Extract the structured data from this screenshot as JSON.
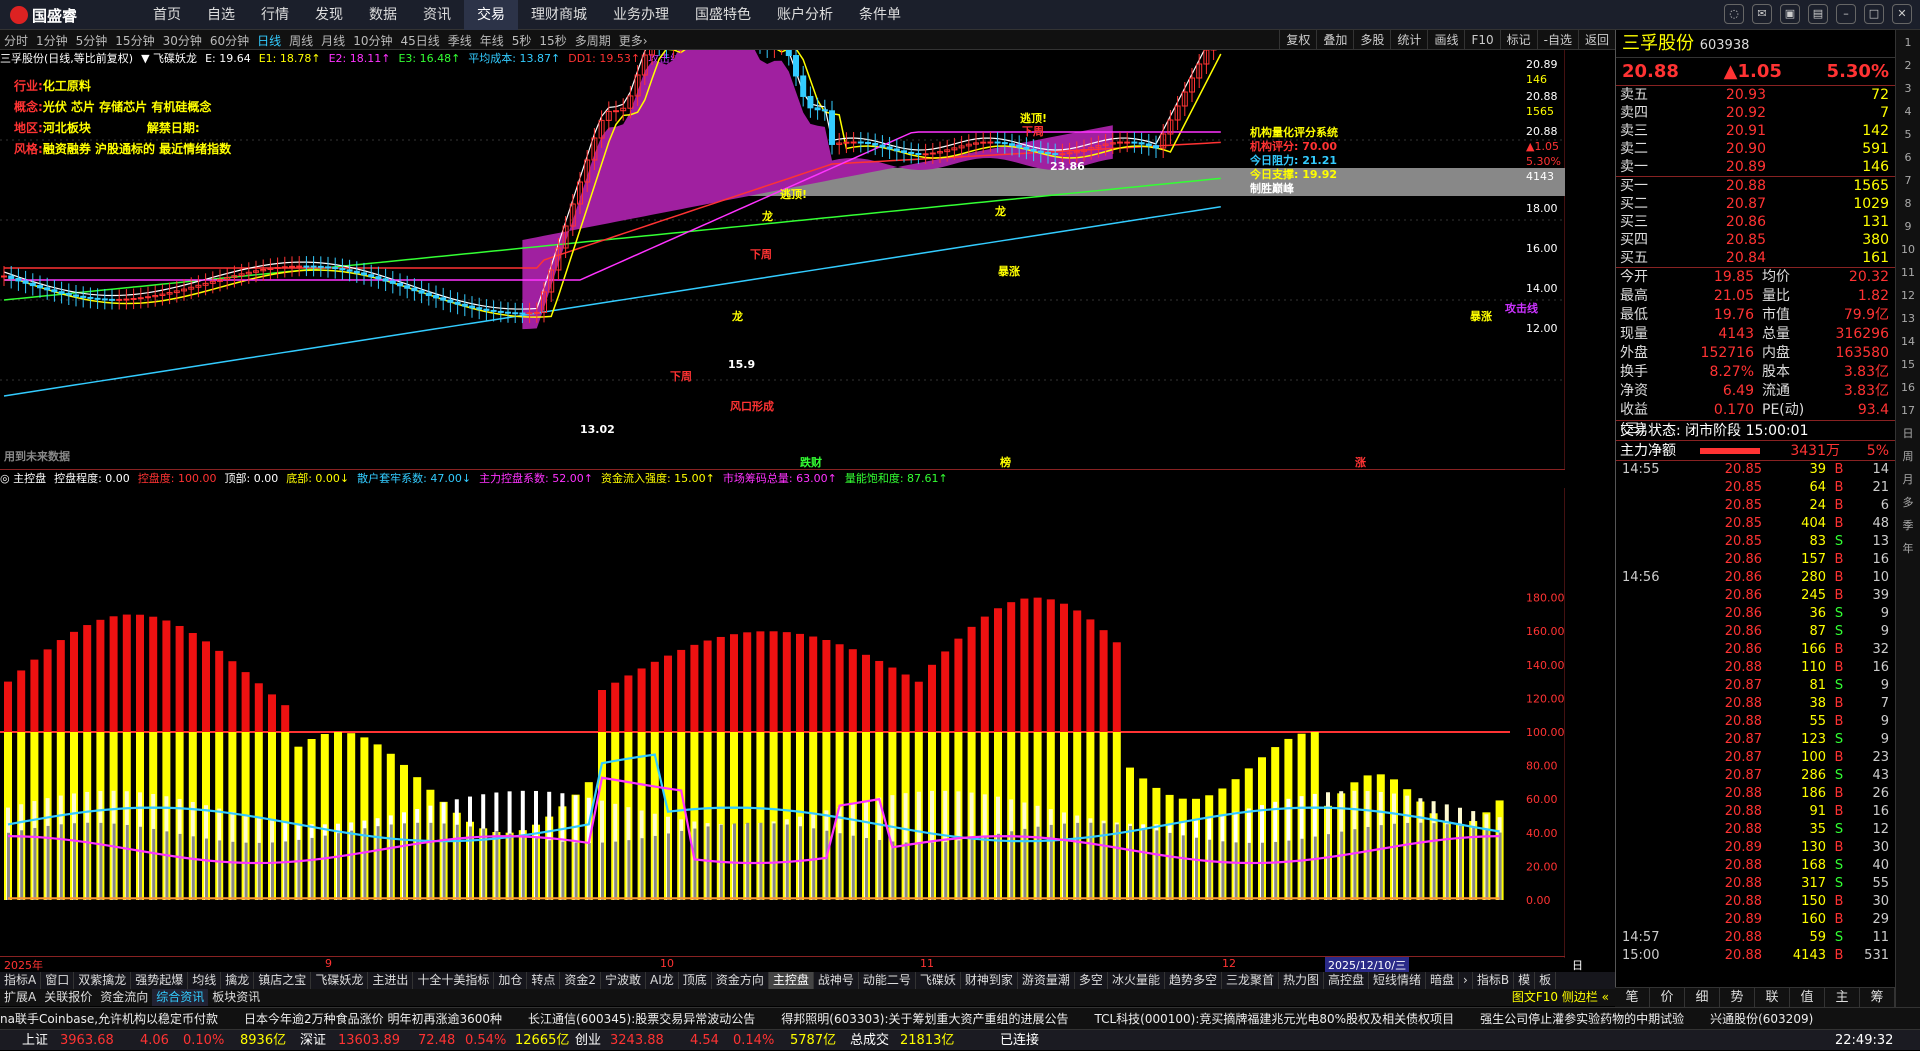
{
  "app": {
    "logo": "国盛睿"
  },
  "menu": [
    "首页",
    "自选",
    "行情",
    "发现",
    "数据",
    "资讯",
    "交易",
    "理财商城",
    "业务办理",
    "国盛特色",
    "账户分析",
    "条件单"
  ],
  "menu_active": 6,
  "periods": [
    "分时",
    "1分钟",
    "5分钟",
    "15分钟",
    "30分钟",
    "60分钟",
    "日线",
    "周线",
    "月线",
    "10分钟",
    "45日线",
    "季线",
    "年线",
    "5秒",
    "15秒",
    "多周期",
    "更多›"
  ],
  "period_active": 6,
  "tools": [
    "复权",
    "叠加",
    "多股",
    "统计",
    "画线",
    "F10",
    "标记",
    "-自选",
    "返回"
  ],
  "kline_info": [
    {
      "t": "三孚股份(日线,等比前复权)",
      "c": "#fff"
    },
    {
      "t": "▼ 飞碟妖龙",
      "c": "#fff"
    },
    {
      "t": "E: 19.64",
      "c": "#fff"
    },
    {
      "t": "E1: 18.78↑",
      "c": "#ff0"
    },
    {
      "t": "E2: 18.11↑",
      "c": "#f3f"
    },
    {
      "t": "E3: 16.48↑",
      "c": "#3f3"
    },
    {
      "t": "平均成本: 13.87↑",
      "c": "#3cf"
    },
    {
      "t": "DD1: 19.53↑",
      "c": "#f33"
    },
    {
      "t": "攻击线: 17.98",
      "c": "#c3f"
    }
  ],
  "annotations": [
    {
      "label": "行业:",
      "value": "化工原料"
    },
    {
      "label": "概念:",
      "value": "光伏 芯片 存储芯片 有机硅概念"
    },
    {
      "label": "地区:",
      "value": "河北板块",
      "label2": "解禁日期:",
      "value2": ""
    },
    {
      "label": "风格:",
      "value": "融资融券 沪股通标的 最近情绪指数"
    }
  ],
  "score": {
    "title": "机构量化评分系统",
    "l1": "机构评分:  70.00",
    "l2": "今日阻力:  21.21",
    "l3": "今日支撑:  19.92",
    "l4": "制胜巅峰"
  },
  "chart_marks": {
    "sell1": "逃顶!",
    "sell2": "逃顶!",
    "dragon": "龙",
    "dragon2": "龙",
    "dragon3": "龙",
    "xiazhou": "下周",
    "xiazhou2": "下周",
    "xiazhou3": "下周",
    "storm": "暴涨",
    "storm2": "暴涨",
    "wind": "风口形成",
    "attack": "攻击线",
    "p_hi": "23.86",
    "p_lo": "13.02",
    "p_mid": "15.9",
    "future": "用到未来数据",
    "lbl_a": "跌财",
    "lbl_b": "榜",
    "lbl_c": "涨"
  },
  "y_main": [
    {
      "v": "20.89"
    },
    {
      "v": "146"
    },
    {
      "v": "20.88"
    },
    {
      "v": "1565"
    },
    {
      "v": "20.88"
    },
    {
      "v": "▲1.05"
    },
    {
      "v": "5.30%"
    },
    {
      "v": "4143"
    },
    {
      "v": "18.00"
    },
    {
      "v": "16.00"
    },
    {
      "v": "14.00"
    },
    {
      "v": "12.00"
    }
  ],
  "indi_info": [
    {
      "t": "◎ 主控盘",
      "c": "#fff"
    },
    {
      "t": "控盘程度: 0.00",
      "c": "#fff"
    },
    {
      "t": "控盘度: 100.00",
      "c": "#f33"
    },
    {
      "t": "顶部: 0.00",
      "c": "#fff"
    },
    {
      "t": "底部: 0.00↓",
      "c": "#ff0"
    },
    {
      "t": "散户套牢系数: 47.00↓",
      "c": "#3cf"
    },
    {
      "t": "主力控盘系数: 52.00↑",
      "c": "#f3f"
    },
    {
      "t": "资金流入强度: 15.00↑",
      "c": "#ff0"
    },
    {
      "t": "市场筹码总量: 63.00↑",
      "c": "#f3f"
    },
    {
      "t": "量能饱和度: 87.61↑",
      "c": "#3f3"
    }
  ],
  "y_sub": [
    "180.00",
    "160.00",
    "140.00",
    "120.00",
    "100.00",
    "80.00",
    "60.00",
    "40.00",
    "20.00",
    "0.00"
  ],
  "dates": [
    "2025年",
    "9",
    "10",
    "11",
    "12",
    "2025/12/10/三",
    "日线"
  ],
  "tabs1": [
    "指标A",
    "窗口",
    "双紫擒龙",
    "强势起爆",
    "均线",
    "擒龙",
    "镇店之宝",
    "飞碟妖龙",
    "主进出",
    "十全十美指标",
    "加仓",
    "转点",
    "资金2",
    "宁波敢",
    "AI龙",
    "顶底",
    "资金方向",
    "主控盘",
    "战神号",
    "动能二号",
    "飞碟妖",
    "财神到家",
    "游资量潮",
    "多空",
    "冰火量能",
    "趋势多空",
    "三龙聚首",
    "热力图",
    "高控盘",
    "短线情绪",
    "暗盘",
    "›",
    "指标B",
    "模",
    "板"
  ],
  "tabs1_active": 17,
  "tabs2": [
    "扩展A",
    "关联报价",
    "资金流向",
    "综合资讯",
    "板块资讯"
  ],
  "tabs2_active": 3,
  "tabs2_right": "图文F10 侧边栏 «",
  "ticker": [
    "na联手Coinbase,允许机构以稳定币付款",
    "日本今年逾2万种食品涨价 明年初再涨逾3600种",
    "长江通信(600345):股票交易异常波动公告",
    "得邦照明(603303):关于筹划重大资产重组的进展公告",
    "TCL科技(000100):竞买摘牌福建兆元光电80%股权及相关债权项目",
    "强生公司停止灌参实验药物的中期试验",
    "兴通股份(603209)"
  ],
  "status": {
    "sh_label": "上证",
    "sh_val": "3963.68",
    "sh_chg": "4.06",
    "sh_pct": "0.10%",
    "sh_amt": "8936亿",
    "sz_label": "深证",
    "sz_val": "13603.89",
    "sz_chg": "72.48",
    "sz_pct": "0.54%",
    "sz_amt": "12665亿",
    "cy_label": "创业",
    "cy_val": "3243.88",
    "cy_chg": "4.54",
    "cy_pct": "0.14%",
    "cy_amt": "5787亿",
    "total_label": "总成交",
    "total_val": "21813亿",
    "conn": "已连接",
    "time": "22:49:32"
  },
  "panel": {
    "name": "三孚股份",
    "code": "603938",
    "price": "20.88",
    "chg": "▲1.05",
    "pct": "5.30%",
    "sells": [
      {
        "l": "卖五",
        "p": "20.93",
        "v": "72"
      },
      {
        "l": "卖四",
        "p": "20.92",
        "v": "7"
      },
      {
        "l": "卖三",
        "p": "20.91",
        "v": "142"
      },
      {
        "l": "卖二",
        "p": "20.90",
        "v": "591"
      },
      {
        "l": "卖一",
        "p": "20.89",
        "v": "146"
      }
    ],
    "buys": [
      {
        "l": "买一",
        "p": "20.88",
        "v": "1565"
      },
      {
        "l": "买二",
        "p": "20.87",
        "v": "1029"
      },
      {
        "l": "买三",
        "p": "20.86",
        "v": "131"
      },
      {
        "l": "买四",
        "p": "20.85",
        "v": "380"
      },
      {
        "l": "买五",
        "p": "20.84",
        "v": "161"
      }
    ],
    "stats": [
      {
        "a": "今开",
        "b": "19.85",
        "c": "均价",
        "d": "20.32"
      },
      {
        "a": "最高",
        "b": "21.05",
        "c": "量比",
        "d": "1.82"
      },
      {
        "a": "最低",
        "b": "19.76",
        "c": "市值",
        "d": "79.9亿"
      },
      {
        "a": "现量",
        "b": "4143",
        "c": "总量",
        "d": "316296"
      },
      {
        "a": "外盘",
        "b": "152716",
        "c": "内盘",
        "d": "163580"
      },
      {
        "a": "换手",
        "b": "8.27%",
        "c": "股本",
        "d": "3.83亿"
      },
      {
        "a": "净资",
        "b": "6.49",
        "c": "流通",
        "d": "3.83亿"
      },
      {
        "a": "收益(三)",
        "b": "0.170",
        "c": "PE(动)",
        "d": "93.4"
      }
    ],
    "trade_state": "交易状态: 闭市阶段 15:00:01",
    "flow_label": "主力净额",
    "flow_val": "3431万",
    "flow_pct": "5%",
    "ticks": [
      {
        "t": "14:55",
        "p": "20.85",
        "v": "39",
        "bs": "B",
        "n": "14"
      },
      {
        "t": "",
        "p": "20.85",
        "v": "64",
        "bs": "B",
        "n": "21"
      },
      {
        "t": "",
        "p": "20.85",
        "v": "24",
        "bs": "B",
        "n": "6"
      },
      {
        "t": "",
        "p": "20.85",
        "v": "404",
        "bs": "B",
        "n": "48"
      },
      {
        "t": "",
        "p": "20.85",
        "v": "83",
        "bs": "S",
        "n": "13"
      },
      {
        "t": "",
        "p": "20.86",
        "v": "157",
        "bs": "B",
        "n": "16"
      },
      {
        "t": "14:56",
        "p": "20.86",
        "v": "280",
        "bs": "B",
        "n": "10"
      },
      {
        "t": "",
        "p": "20.86",
        "v": "245",
        "bs": "B",
        "n": "39"
      },
      {
        "t": "",
        "p": "20.86",
        "v": "36",
        "bs": "S",
        "n": "9"
      },
      {
        "t": "",
        "p": "20.86",
        "v": "87",
        "bs": "S",
        "n": "9"
      },
      {
        "t": "",
        "p": "20.86",
        "v": "166",
        "bs": "B",
        "n": "32"
      },
      {
        "t": "",
        "p": "20.88",
        "v": "110",
        "bs": "B",
        "n": "16"
      },
      {
        "t": "",
        "p": "20.87",
        "v": "81",
        "bs": "S",
        "n": "9"
      },
      {
        "t": "",
        "p": "20.88",
        "v": "38",
        "bs": "B",
        "n": "7"
      },
      {
        "t": "",
        "p": "20.88",
        "v": "55",
        "bs": "B",
        "n": "9"
      },
      {
        "t": "",
        "p": "20.87",
        "v": "123",
        "bs": "S",
        "n": "9"
      },
      {
        "t": "",
        "p": "20.87",
        "v": "100",
        "bs": "B",
        "n": "23"
      },
      {
        "t": "",
        "p": "20.87",
        "v": "286",
        "bs": "S",
        "n": "43"
      },
      {
        "t": "",
        "p": "20.88",
        "v": "186",
        "bs": "B",
        "n": "26"
      },
      {
        "t": "",
        "p": "20.88",
        "v": "91",
        "bs": "B",
        "n": "16"
      },
      {
        "t": "",
        "p": "20.88",
        "v": "35",
        "bs": "S",
        "n": "12"
      },
      {
        "t": "",
        "p": "20.89",
        "v": "130",
        "bs": "B",
        "n": "30"
      },
      {
        "t": "",
        "p": "20.88",
        "v": "168",
        "bs": "S",
        "n": "40"
      },
      {
        "t": "",
        "p": "20.88",
        "v": "317",
        "bs": "S",
        "n": "55"
      },
      {
        "t": "",
        "p": "20.88",
        "v": "150",
        "bs": "B",
        "n": "30"
      },
      {
        "t": "",
        "p": "20.89",
        "v": "160",
        "bs": "B",
        "n": "29"
      },
      {
        "t": "14:57",
        "p": "20.88",
        "v": "59",
        "bs": "S",
        "n": "11"
      },
      {
        "t": "15:00",
        "p": "20.88",
        "v": "4143",
        "bs": "B",
        "n": "531"
      }
    ],
    "bottom_tabs": [
      "笔",
      "价",
      "细",
      "势",
      "联",
      "值",
      "主",
      "筹"
    ]
  },
  "sidebar": [
    "1",
    "2",
    "3",
    "4",
    "5",
    "6",
    "7",
    "8",
    "9",
    "10",
    "11",
    "12",
    "13",
    "14",
    "15",
    "16",
    "17",
    "日",
    "周",
    "月",
    "多",
    "季",
    "年"
  ]
}
